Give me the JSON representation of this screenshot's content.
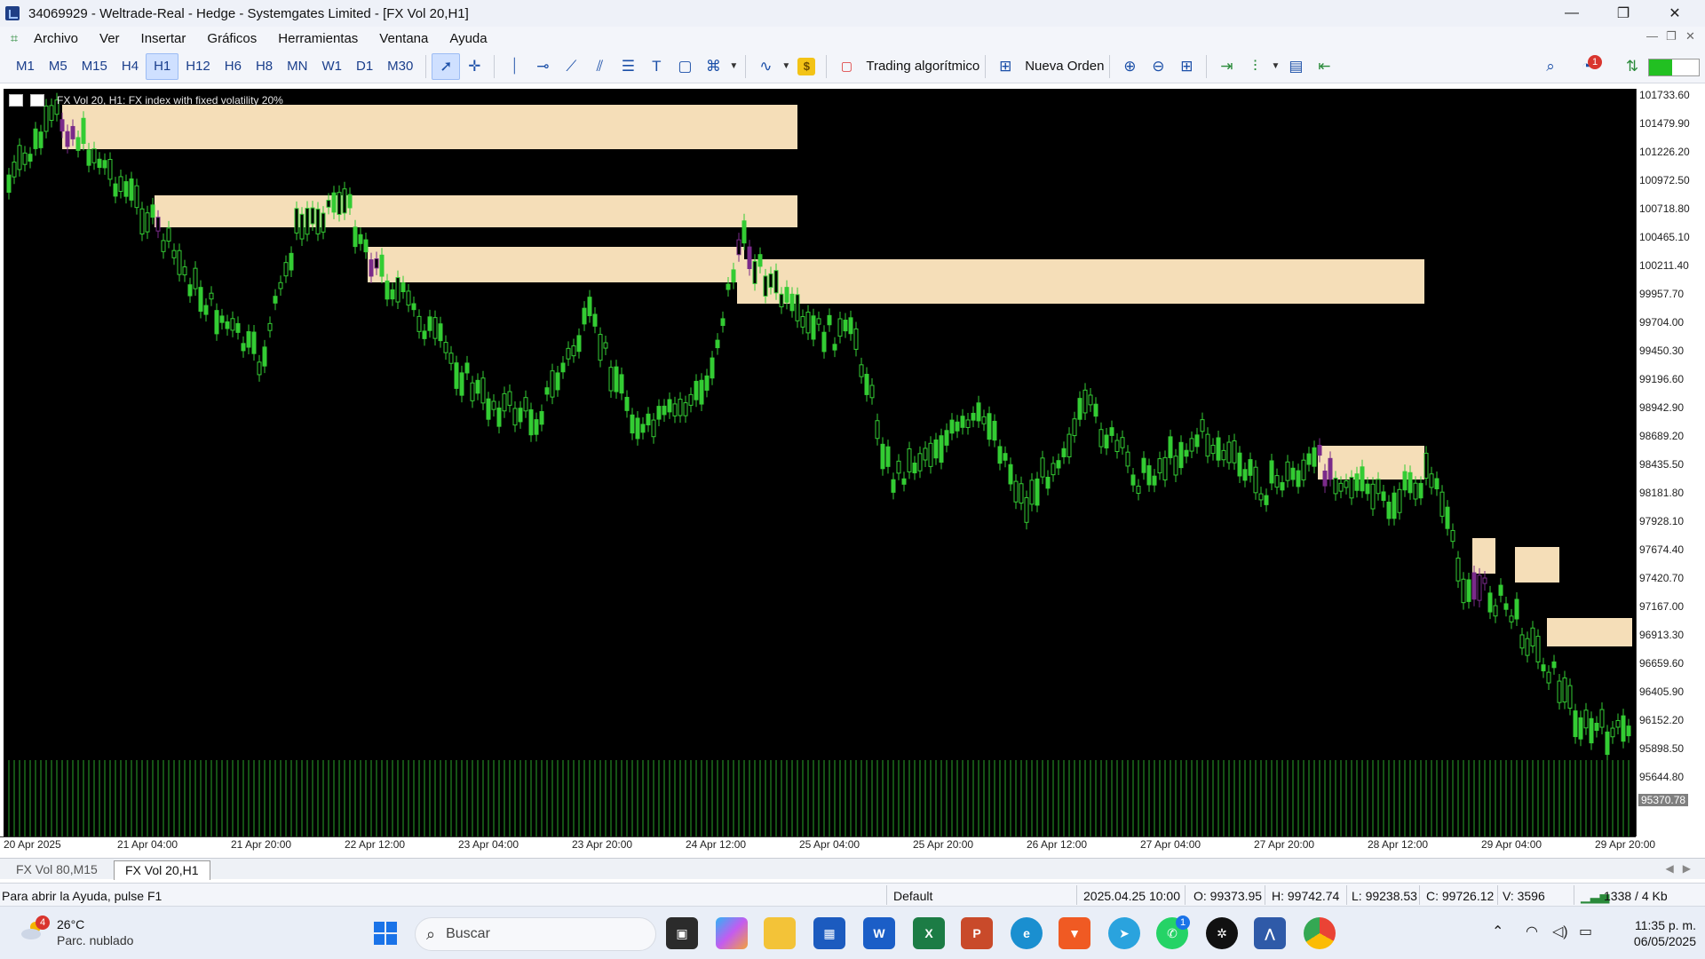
{
  "window": {
    "title": "34069929 - Weltrade-Real - Hedge - Systemgates Limited - [FX Vol 20,H1]",
    "minimize": "—",
    "maximize": "❐",
    "close": "✕"
  },
  "menu": {
    "items": [
      "Archivo",
      "Ver",
      "Insertar",
      "Gráficos",
      "Herramientas",
      "Ventana",
      "Ayuda"
    ],
    "mdi_min": "—",
    "mdi_restore": "❐",
    "mdi_close": "✕"
  },
  "toolbar": {
    "timeframes": [
      "M1",
      "M5",
      "M15",
      "H4",
      "H1",
      "H12",
      "H6",
      "H8",
      "MN",
      "W1",
      "D1",
      "M30"
    ],
    "active_timeframe": "H1",
    "algo_label": "Trading algorítmico",
    "new_order_label": "Nueva Orden",
    "notification_count": "1",
    "icons": [
      "cursor-icon",
      "crosshair-icon",
      "vertical-line-icon",
      "horizontal-line-icon",
      "trendline-icon",
      "channel-icon",
      "fibonacci-icon",
      "text-icon",
      "rectangle-icon",
      "shapes-icon",
      "indicators-icon",
      "signals-icon",
      "zoom-in-icon",
      "zoom-out-icon",
      "tile-icon",
      "scroll-icon",
      "chart-type-icon",
      "template-icon",
      "shift-icon"
    ]
  },
  "chart": {
    "symbol_info": "FX Vol 20, H1:  FX index with fixed volatility 20%",
    "price_labels": [
      "101733.60",
      "101479.90",
      "101226.20",
      "100972.50",
      "100718.80",
      "100465.10",
      "100211.40",
      "99957.70",
      "99704.00",
      "99450.30",
      "99196.60",
      "98942.90",
      "98689.20",
      "98435.50",
      "98181.80",
      "97928.10",
      "97674.40",
      "97420.70",
      "97167.00",
      "96913.30",
      "96659.60",
      "96405.90",
      "96152.20",
      "95898.50",
      "95644.80"
    ],
    "current_price_label": "95370.78",
    "time_labels": [
      "20 Apr 2025",
      "21 Apr 04:00",
      "21 Apr 20:00",
      "22 Apr 12:00",
      "23 Apr 04:00",
      "23 Apr 20:00",
      "24 Apr 12:00",
      "25 Apr 04:00",
      "25 Apr 20:00",
      "26 Apr 12:00",
      "27 Apr 04:00",
      "27 Apr 20:00",
      "28 Apr 12:00",
      "29 Apr 04:00",
      "29 Apr 20:00"
    ],
    "colors": {
      "background": "#000000",
      "bull_candle": "#33cc33",
      "zone_fill": "#f5deb8",
      "zone_candle": "#7a2a8a",
      "volume": "#2aa52a"
    }
  },
  "tabs": {
    "items": [
      "FX Vol 80,M15",
      "FX Vol 20,H1"
    ],
    "active": "FX Vol 20,H1"
  },
  "status": {
    "help": "Para abrir la Ayuda, pulse F1",
    "profile": "Default",
    "datetime": "2025.04.25 10:00",
    "open": "O: 99373.95",
    "high": "H: 99742.74",
    "low": "L: 99238.53",
    "close": "C: 99726.12",
    "volume": "V: 3596",
    "connection": "1338 / 4 Kb"
  },
  "taskbar": {
    "weather_badge": "4",
    "temperature": "26°C",
    "weather_desc": "Parc. nublado",
    "search_placeholder": "Buscar",
    "whatsapp_badge": "1",
    "time": "11:35 p. m.",
    "date": "06/05/2025"
  }
}
